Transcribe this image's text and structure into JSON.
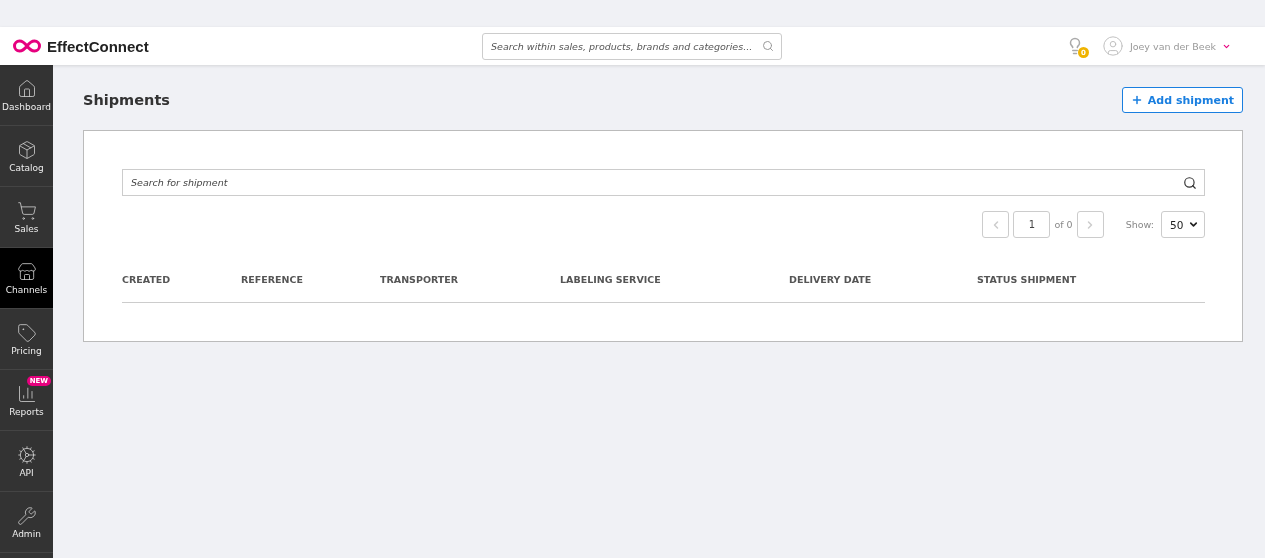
{
  "header": {
    "logo": "EffectConnect",
    "search": {
      "placeholder": "Search within sales, products, brands and categories..."
    },
    "notifications": {
      "count": "0"
    },
    "user": {
      "name": "Joey van der Beek"
    }
  },
  "sidebar": {
    "items": [
      {
        "label": "Dashboard",
        "selected": false
      },
      {
        "label": "Catalog",
        "selected": false
      },
      {
        "label": "Sales",
        "selected": false
      },
      {
        "label": "Channels",
        "selected": true
      },
      {
        "label": "Pricing",
        "selected": false
      },
      {
        "label": "Reports",
        "selected": false,
        "badge": "NEW"
      },
      {
        "label": "API",
        "selected": false
      },
      {
        "label": "Admin",
        "selected": false
      }
    ]
  },
  "page": {
    "title": "Shipments",
    "add_button": "Add shipment"
  },
  "panel": {
    "search": {
      "placeholder": "Search for shipment"
    },
    "pagination": {
      "page": "1",
      "of": "of 0",
      "show_label": "Show:",
      "page_size": "50"
    },
    "table": {
      "columns": [
        "CREATED",
        "REFERENCE",
        "TRANSPORTER",
        "LABELING SERVICE",
        "DELIVERY DATE",
        "STATUS SHIPMENT"
      ]
    }
  }
}
